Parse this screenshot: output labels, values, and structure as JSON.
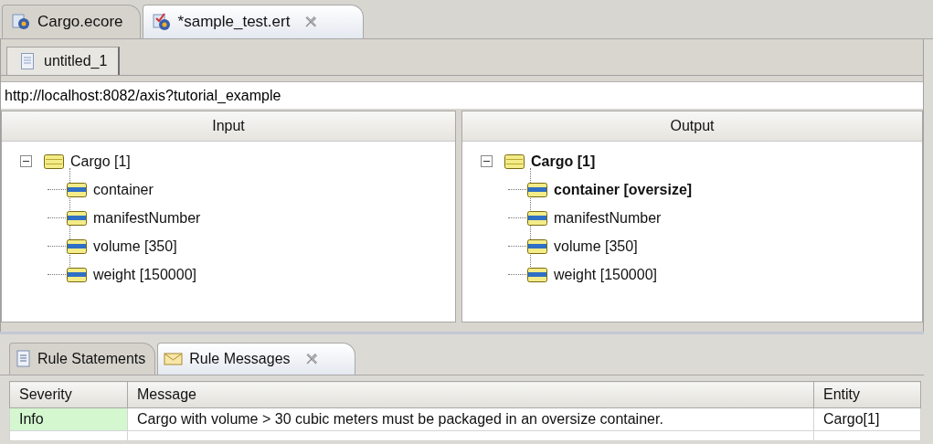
{
  "editor_tabs": [
    {
      "label": "Cargo.ecore",
      "kind": "model",
      "selected": false,
      "closable": false
    },
    {
      "label": "*sample_test.ert",
      "kind": "test",
      "selected": true,
      "closable": true
    }
  ],
  "sub_tabs": [
    {
      "label": "untitled_1",
      "selected": true
    }
  ],
  "url_field": {
    "value": "http://localhost:8082/axis?tutorial_example"
  },
  "panels": [
    {
      "title": "Input",
      "tree": [
        {
          "label": "Cargo [1]",
          "changed": false,
          "expanded": true,
          "children": [
            {
              "label": "container",
              "changed": false
            },
            {
              "label": "manifestNumber",
              "changed": false
            },
            {
              "label": "volume [350]",
              "changed": false
            },
            {
              "label": "weight [150000]",
              "changed": false
            }
          ]
        }
      ]
    },
    {
      "title": "Output",
      "tree": [
        {
          "label": "Cargo [1]",
          "changed": true,
          "expanded": true,
          "children": [
            {
              "label": "container [oversize]",
              "changed": true
            },
            {
              "label": "manifestNumber",
              "changed": false
            },
            {
              "label": "volume [350]",
              "changed": false
            },
            {
              "label": "weight [150000]",
              "changed": false
            }
          ]
        }
      ]
    }
  ],
  "view_tabs": [
    {
      "label": "Rule Statements",
      "kind": "statements",
      "selected": false,
      "closable": false
    },
    {
      "label": "Rule Messages",
      "kind": "messages",
      "selected": true,
      "closable": true
    }
  ],
  "table": {
    "columns": [
      "Severity",
      "Message",
      "Entity"
    ],
    "rows": [
      {
        "severity": "Info",
        "color": "#d4f7d0",
        "message": "Cargo with volume > 30 cubic meters must be packaged in an oversize container.",
        "entity": "Cargo[1]"
      }
    ]
  }
}
